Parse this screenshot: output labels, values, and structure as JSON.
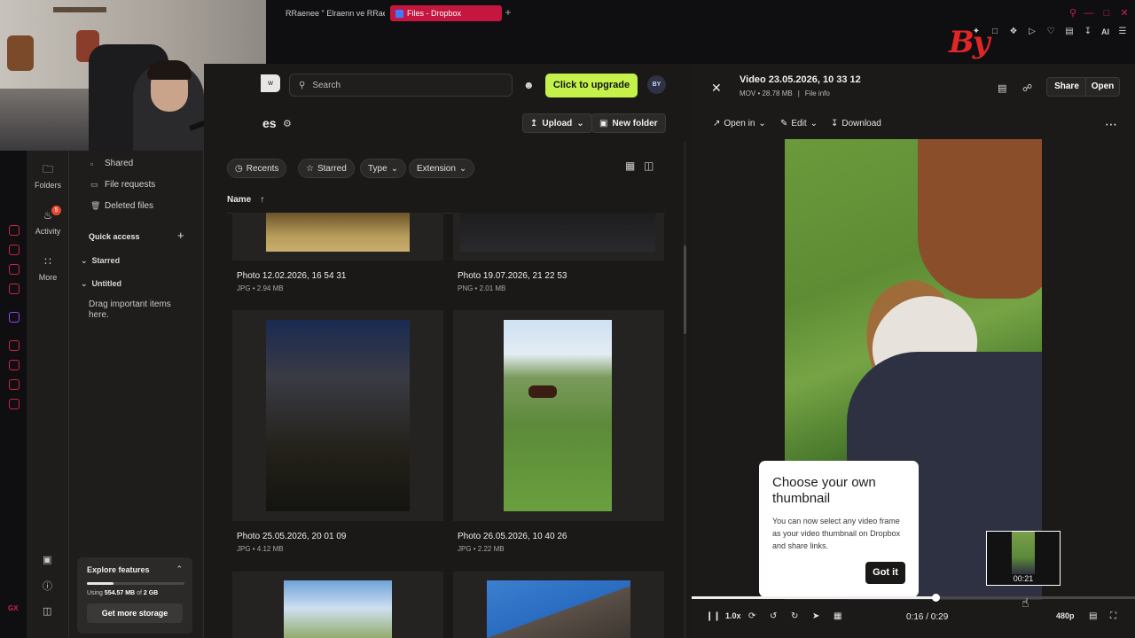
{
  "browser": {
    "tabs": [
      {
        "label": "RRaenee \" Elraenn ve RRae",
        "icon": "youtube-icon"
      },
      {
        "label": "Files - Dropbox",
        "icon": "dropbox-icon"
      }
    ],
    "new_tab": "+",
    "extension_ai": "AI"
  },
  "overlay": {
    "logo_text": "By"
  },
  "nav_rail": {
    "folders": "Folders",
    "activity": "Activity",
    "activity_badge": "5",
    "more": "More"
  },
  "sidebar": {
    "links": [
      "Shared",
      "File requests",
      "Deleted files"
    ],
    "quick_access": "Quick access",
    "starred": "Starred",
    "untitled": "Untitled",
    "drag_hint": "Drag important items here.",
    "explore": {
      "title": "Explore features",
      "used": "554.57 MB",
      "total": "2 GB",
      "using_prefix": "Using",
      "of_word": "of",
      "usage_fraction": 0.277,
      "button": "Get more storage"
    }
  },
  "main": {
    "topbar_pill": "w",
    "search_placeholder": "Search",
    "upgrade": "Click to upgrade",
    "avatar": "BY",
    "title_fragment": "es",
    "upload": "Upload",
    "new_folder": "New folder",
    "filters": [
      "Recents",
      "Starred",
      "Type",
      "Extension"
    ],
    "name_header": "Name",
    "files": [
      {
        "name": "Photo 12.02.2026, 16 54 31",
        "meta": "JPG • 2.94 MB"
      },
      {
        "name": "Photo 19.07.2026, 21 22 53",
        "meta": "PNG • 2.01 MB"
      },
      {
        "name": "Photo 25.05.2026, 20 01 09",
        "meta": "JPG • 4.12 MB"
      },
      {
        "name": "Photo 26.05.2026, 10 40 26",
        "meta": "JPG • 2.22 MB"
      }
    ]
  },
  "preview": {
    "title": "Video 23.05.2026, 10 33 12",
    "meta": "MOV • 28.78 MB",
    "file_info": "File info",
    "share": "Share",
    "open": "Open",
    "open_in": "Open in",
    "edit": "Edit",
    "download": "Download",
    "tooltip": {
      "title": "Choose your own thumbnail",
      "text": "You can now select any video frame as your video thumbnail on Dropbox and share links.",
      "button": "Got it"
    },
    "hover_time": "00:21",
    "progress_fraction": 0.55,
    "speed": "1.0x",
    "time": "0:16 / 0:29",
    "quality": "480p",
    "skip_back": "10",
    "skip_forward": "10"
  }
}
